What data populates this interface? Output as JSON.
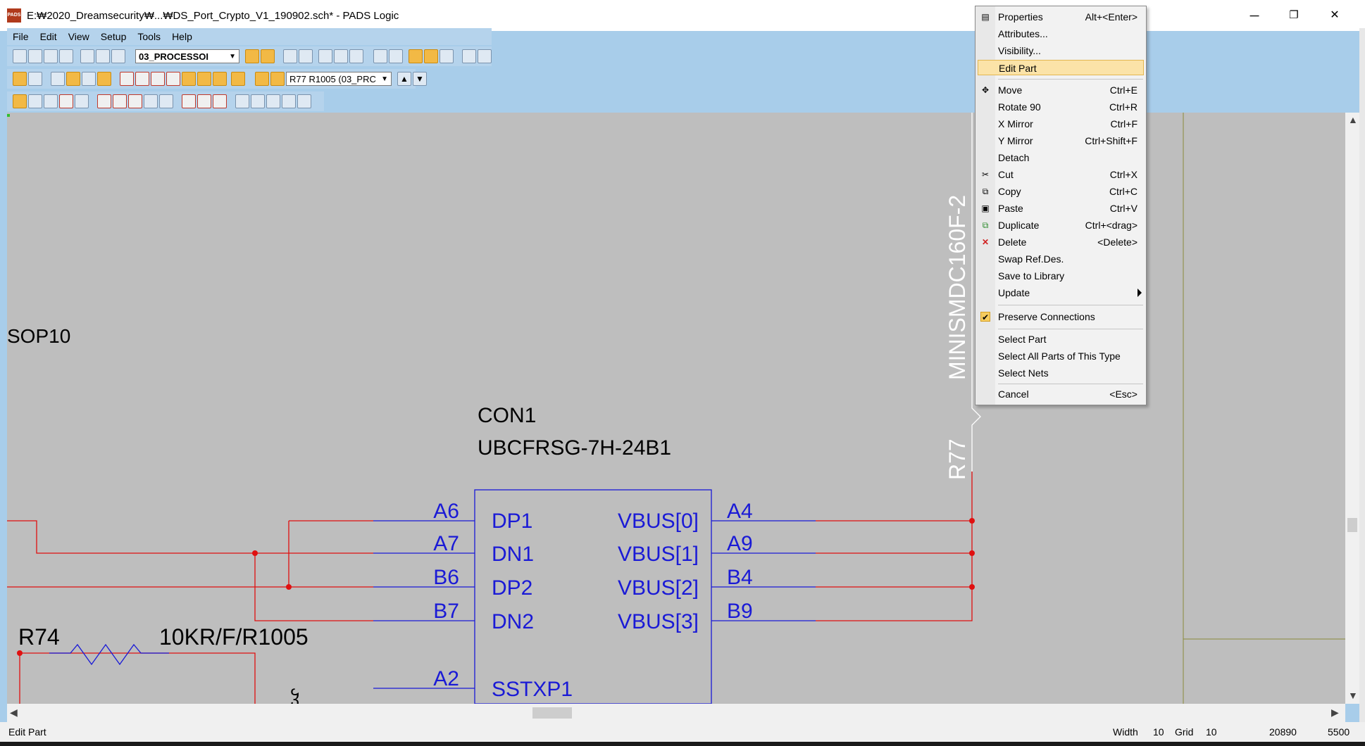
{
  "window": {
    "title": "E:₩2020_Dreamsecurity₩...₩DS_Port_Crypto_V1_190902.sch* - PADS Logic",
    "app_icon_text": "PADS",
    "minimize": "─",
    "maximize": "❐",
    "close": "✕"
  },
  "menu": {
    "items": [
      "File",
      "Edit",
      "View",
      "Setup",
      "Tools",
      "Help"
    ]
  },
  "toolbar": {
    "sheet_select": "03_PROCESSOI",
    "part_select": "R77 R1005 (03_PRC"
  },
  "schematic": {
    "sop_label": "SOP10",
    "con_ref": "CON1",
    "con_part": "UBCFRSG-7H-24B1",
    "left_pin_numbers": [
      "A6",
      "A7",
      "B6",
      "B7",
      "A2"
    ],
    "left_pin_names": [
      "DP1",
      "DN1",
      "DP2",
      "DN2",
      "SSTXP1"
    ],
    "right_pin_names": [
      "VBUS[0]",
      "VBUS[1]",
      "VBUS[2]",
      "VBUS[3]"
    ],
    "right_pin_numbers": [
      "A4",
      "A9",
      "B4",
      "B9"
    ],
    "r74_ref": "R74",
    "r74_value": "10KR/F/R1005",
    "r77_ref": "R77",
    "r77_part": "MINISMDC160F-2",
    "partial_glyph": "ჴ",
    "colors": {
      "wire": "#e01010",
      "symbol": "#1a1ad6",
      "canvas": "#bebebe"
    }
  },
  "context_menu": {
    "items": [
      {
        "label": "Properties",
        "accel": "Alt+<Enter>",
        "icon": "properties-icon"
      },
      {
        "label": "Attributes...",
        "accel": ""
      },
      {
        "label": "Visibility...",
        "accel": ""
      },
      {
        "label": "Edit Part",
        "accel": "",
        "highlighted": true
      },
      {
        "label": "Move",
        "accel": "Ctrl+E",
        "icon": "move-icon"
      },
      {
        "label": "Rotate 90",
        "accel": "Ctrl+R"
      },
      {
        "label": "X Mirror",
        "accel": "Ctrl+F"
      },
      {
        "label": "Y Mirror",
        "accel": "Ctrl+Shift+F"
      },
      {
        "label": "Detach",
        "accel": ""
      },
      {
        "label": "Cut",
        "accel": "Ctrl+X",
        "icon": "scissors-icon"
      },
      {
        "label": "Copy",
        "accel": "Ctrl+C",
        "icon": "copy-icon"
      },
      {
        "label": "Paste",
        "accel": "Ctrl+V",
        "icon": "paste-icon"
      },
      {
        "label": "Duplicate",
        "accel": "Ctrl+<drag>",
        "icon": "duplicate-icon"
      },
      {
        "label": "Delete",
        "accel": "<Delete>",
        "icon": "delete-icon"
      },
      {
        "label": "Swap Ref.Des.",
        "accel": ""
      },
      {
        "label": "Save to Library",
        "accel": ""
      },
      {
        "label": "Update",
        "accel": "",
        "submenu": true
      },
      {
        "label": "Preserve Connections",
        "accel": "",
        "checked": true
      },
      {
        "label": "Select Part",
        "accel": ""
      },
      {
        "label": "Select All Parts of This Type",
        "accel": ""
      },
      {
        "label": "Select Nets",
        "accel": ""
      },
      {
        "label": "Cancel",
        "accel": "<Esc>"
      }
    ]
  },
  "status": {
    "message": "Edit Part",
    "width_label": "Width",
    "width_value": "10",
    "grid_label": "Grid",
    "grid_value": "10",
    "x": "20890",
    "y": "5500"
  }
}
